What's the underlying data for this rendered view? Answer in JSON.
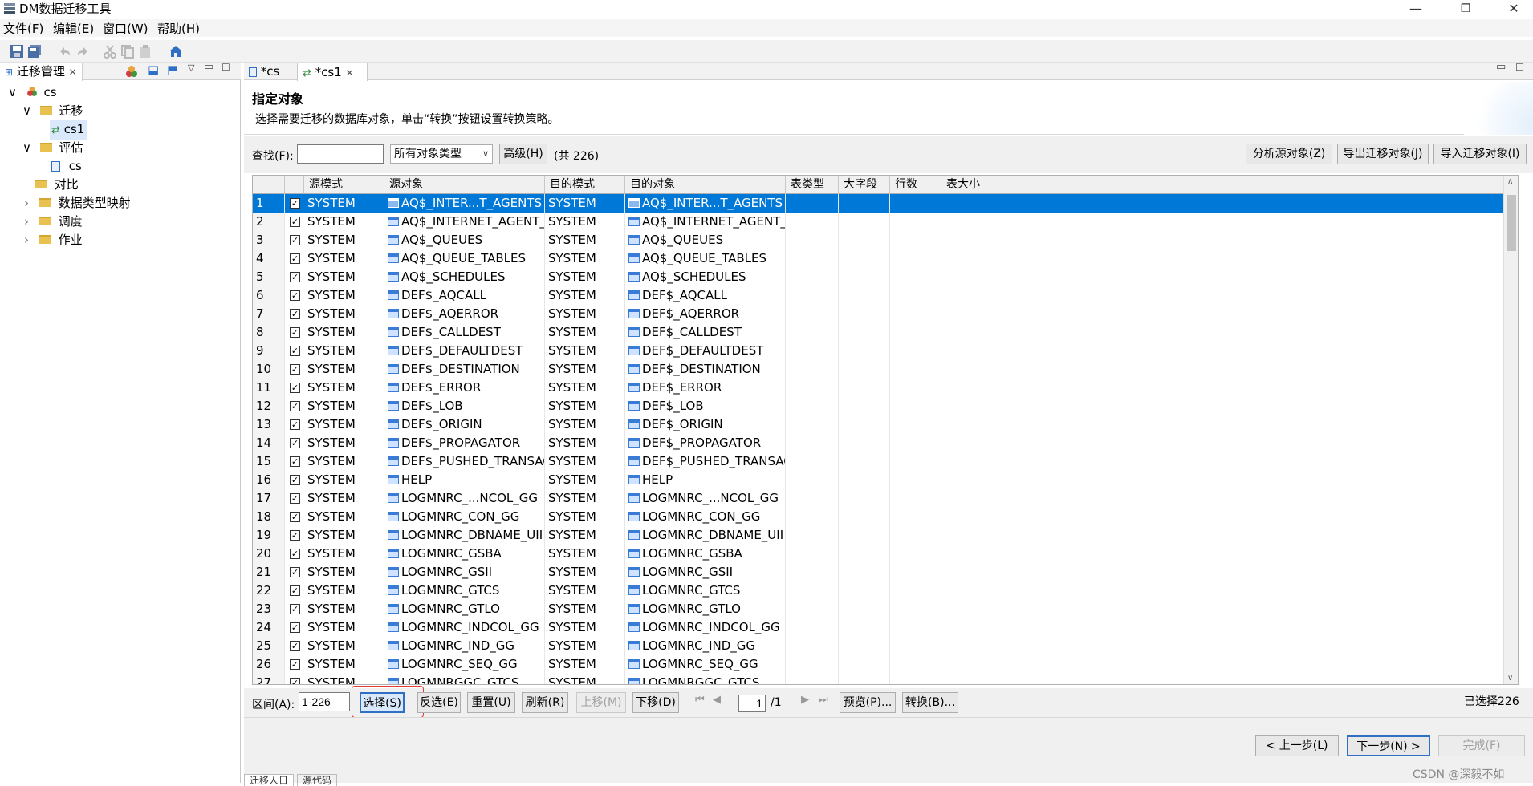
{
  "window": {
    "title": "DM数据迁移工具",
    "min": "—",
    "restore": "❐",
    "close": "✕"
  },
  "menu": [
    "文件(F)",
    "编辑(E)",
    "窗口(W)",
    "帮助(H)"
  ],
  "left": {
    "tab_label": "迁移管理",
    "tree": [
      {
        "label": "cs",
        "depth": 0,
        "expander": "∨"
      },
      {
        "label": "迁移",
        "depth": 1,
        "expander": "∨"
      },
      {
        "label": "cs1",
        "depth": 2,
        "expander": ""
      },
      {
        "label": "评估",
        "depth": 1,
        "expander": "∨"
      },
      {
        "label": "cs",
        "depth": 2,
        "expander": ""
      },
      {
        "label": "对比",
        "depth": 1,
        "expander": ""
      },
      {
        "label": "数据类型映射",
        "depth": 1,
        "expander": "›"
      },
      {
        "label": "调度",
        "depth": 1,
        "expander": "›"
      },
      {
        "label": "作业",
        "depth": 1,
        "expander": "›"
      }
    ]
  },
  "editor_tabs": [
    {
      "label": "*cs"
    },
    {
      "label": "*cs1"
    }
  ],
  "page": {
    "heading": "指定对象",
    "description": "选择需要迁移的数据库对象，单击“转换”按钮设置转换策略。"
  },
  "search": {
    "label": "查找(F):",
    "value": "",
    "type_select": "所有对象类型",
    "advanced": "高级(H)",
    "count": "(共 226)",
    "analyze": "分析源对象(Z)",
    "export": "导出迁移对象(J)",
    "import": "导入迁移对象(I)"
  },
  "grid": {
    "columns": [
      "",
      "",
      "源模式",
      "源对象",
      "目的模式",
      "目的对象",
      "表类型",
      "大字段",
      "行数",
      "表大小"
    ],
    "rows": [
      [
        "1",
        "SYSTEM",
        "AQ$_INTER...T_AGENTS",
        "SYSTEM",
        "AQ$_INTER...T_AGENTS"
      ],
      [
        "2",
        "SYSTEM",
        "AQ$_INTERNET_AGENT_",
        "SYSTEM",
        "AQ$_INTERNET_AGENT_"
      ],
      [
        "3",
        "SYSTEM",
        "AQ$_QUEUES",
        "SYSTEM",
        "AQ$_QUEUES"
      ],
      [
        "4",
        "SYSTEM",
        "AQ$_QUEUE_TABLES",
        "SYSTEM",
        "AQ$_QUEUE_TABLES"
      ],
      [
        "5",
        "SYSTEM",
        "AQ$_SCHEDULES",
        "SYSTEM",
        "AQ$_SCHEDULES"
      ],
      [
        "6",
        "SYSTEM",
        "DEF$_AQCALL",
        "SYSTEM",
        "DEF$_AQCALL"
      ],
      [
        "7",
        "SYSTEM",
        "DEF$_AQERROR",
        "SYSTEM",
        "DEF$_AQERROR"
      ],
      [
        "8",
        "SYSTEM",
        "DEF$_CALLDEST",
        "SYSTEM",
        "DEF$_CALLDEST"
      ],
      [
        "9",
        "SYSTEM",
        "DEF$_DEFAULTDEST",
        "SYSTEM",
        "DEF$_DEFAULTDEST"
      ],
      [
        "10",
        "SYSTEM",
        "DEF$_DESTINATION",
        "SYSTEM",
        "DEF$_DESTINATION"
      ],
      [
        "11",
        "SYSTEM",
        "DEF$_ERROR",
        "SYSTEM",
        "DEF$_ERROR"
      ],
      [
        "12",
        "SYSTEM",
        "DEF$_LOB",
        "SYSTEM",
        "DEF$_LOB"
      ],
      [
        "13",
        "SYSTEM",
        "DEF$_ORIGIN",
        "SYSTEM",
        "DEF$_ORIGIN"
      ],
      [
        "14",
        "SYSTEM",
        "DEF$_PROPAGATOR",
        "SYSTEM",
        "DEF$_PROPAGATOR"
      ],
      [
        "15",
        "SYSTEM",
        "DEF$_PUSHED_TRANSAC",
        "SYSTEM",
        "DEF$_PUSHED_TRANSAC"
      ],
      [
        "16",
        "SYSTEM",
        "HELP",
        "SYSTEM",
        "HELP"
      ],
      [
        "17",
        "SYSTEM",
        "LOGMNRC_...NCOL_GG",
        "SYSTEM",
        "LOGMNRC_...NCOL_GG"
      ],
      [
        "18",
        "SYSTEM",
        "LOGMNRC_CON_GG",
        "SYSTEM",
        "LOGMNRC_CON_GG"
      ],
      [
        "19",
        "SYSTEM",
        "LOGMNRC_DBNAME_UII",
        "SYSTEM",
        "LOGMNRC_DBNAME_UII"
      ],
      [
        "20",
        "SYSTEM",
        "LOGMNRC_GSBA",
        "SYSTEM",
        "LOGMNRC_GSBA"
      ],
      [
        "21",
        "SYSTEM",
        "LOGMNRC_GSII",
        "SYSTEM",
        "LOGMNRC_GSII"
      ],
      [
        "22",
        "SYSTEM",
        "LOGMNRC_GTCS",
        "SYSTEM",
        "LOGMNRC_GTCS"
      ],
      [
        "23",
        "SYSTEM",
        "LOGMNRC_GTLO",
        "SYSTEM",
        "LOGMNRC_GTLO"
      ],
      [
        "24",
        "SYSTEM",
        "LOGMNRC_INDCOL_GG",
        "SYSTEM",
        "LOGMNRC_INDCOL_GG"
      ],
      [
        "25",
        "SYSTEM",
        "LOGMNRC_IND_GG",
        "SYSTEM",
        "LOGMNRC_IND_GG"
      ],
      [
        "26",
        "SYSTEM",
        "LOGMNRC_SEQ_GG",
        "SYSTEM",
        "LOGMNRC_SEQ_GG"
      ],
      [
        "27",
        "SYSTEM",
        "LOGMNRGGC_GTCS",
        "SYSTEM",
        "LOGMNRGGC_GTCS"
      ]
    ],
    "selected_row": 0
  },
  "paging": {
    "range_label": "区间(A):",
    "range_value": "1-226",
    "select": "选择(S)",
    "invert": "反选(E)",
    "reset": "重置(U)",
    "refresh": "刷新(R)",
    "up": "上移(M)",
    "down": "下移(D)",
    "page_value": "1",
    "page_total": "/1",
    "preview": "预览(P)...",
    "convert": "转换(B)...",
    "selected_count": "已选择226"
  },
  "wizard": {
    "prev": "< 上一步(L)",
    "next": "下一步(N) >",
    "finish": "完成(F)"
  },
  "bottom_tabs": [
    "迁移人日",
    "源代码"
  ],
  "watermark": "CSDN @深毅不如",
  "colors": {
    "selection": "#0078d7",
    "folder": "#e8c150",
    "highlight_box": "#e53935"
  }
}
